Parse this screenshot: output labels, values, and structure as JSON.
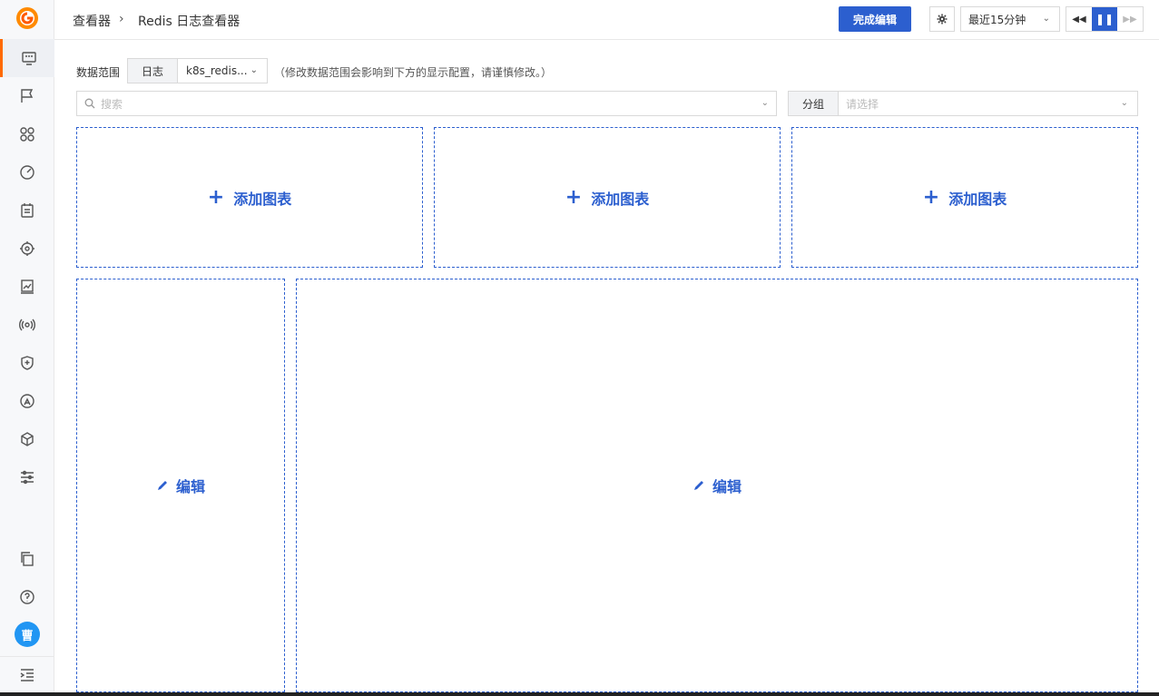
{
  "header": {
    "breadcrumb_root": "查看器",
    "breadcrumb_sep": "›",
    "breadcrumb_current": "Redis 日志查看器",
    "finish_button": "完成编辑",
    "time_range": "最近15分钟"
  },
  "scope": {
    "label": "数据范围",
    "type": "日志",
    "source": "k8s_redis...",
    "hint": "（修改数据范围会影响到下方的显示配置，请谨慎修改。）"
  },
  "filter": {
    "search_placeholder": "搜索",
    "group_label": "分组",
    "group_placeholder": "请选择"
  },
  "panels": {
    "add_chart_label": "添加图表",
    "edit_label": "编辑"
  },
  "user": {
    "avatar_text": "曹"
  },
  "colors": {
    "primary": "#2c5fcf",
    "accent": "#ff6a00",
    "avatar": "#2196f3"
  }
}
